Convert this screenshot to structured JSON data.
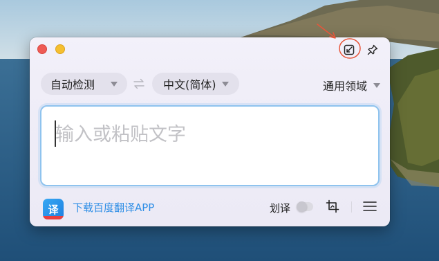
{
  "window": {
    "buttons": {
      "close": "close",
      "minimize": "minimize"
    }
  },
  "toolbar": {
    "source_language": "自动检测",
    "target_language": "中文(简体)",
    "domain": "通用领域"
  },
  "input": {
    "placeholder": "输入或粘贴文字",
    "value": ""
  },
  "footer": {
    "download_link": "下载百度翻译APP",
    "app_icon_glyph": "译",
    "word_translation_label": "划译",
    "word_translation_enabled": false
  },
  "icons": {
    "mini_mode": "shrink-window-icon",
    "pin": "pin-icon",
    "swap": "swap-arrows-icon",
    "screenshot": "screenshot-translate-icon",
    "menu": "hamburger-menu-icon"
  },
  "colors": {
    "accent": "#2e8ee6",
    "input_border": "#8fc3ee",
    "annotation": "#e8553a"
  }
}
